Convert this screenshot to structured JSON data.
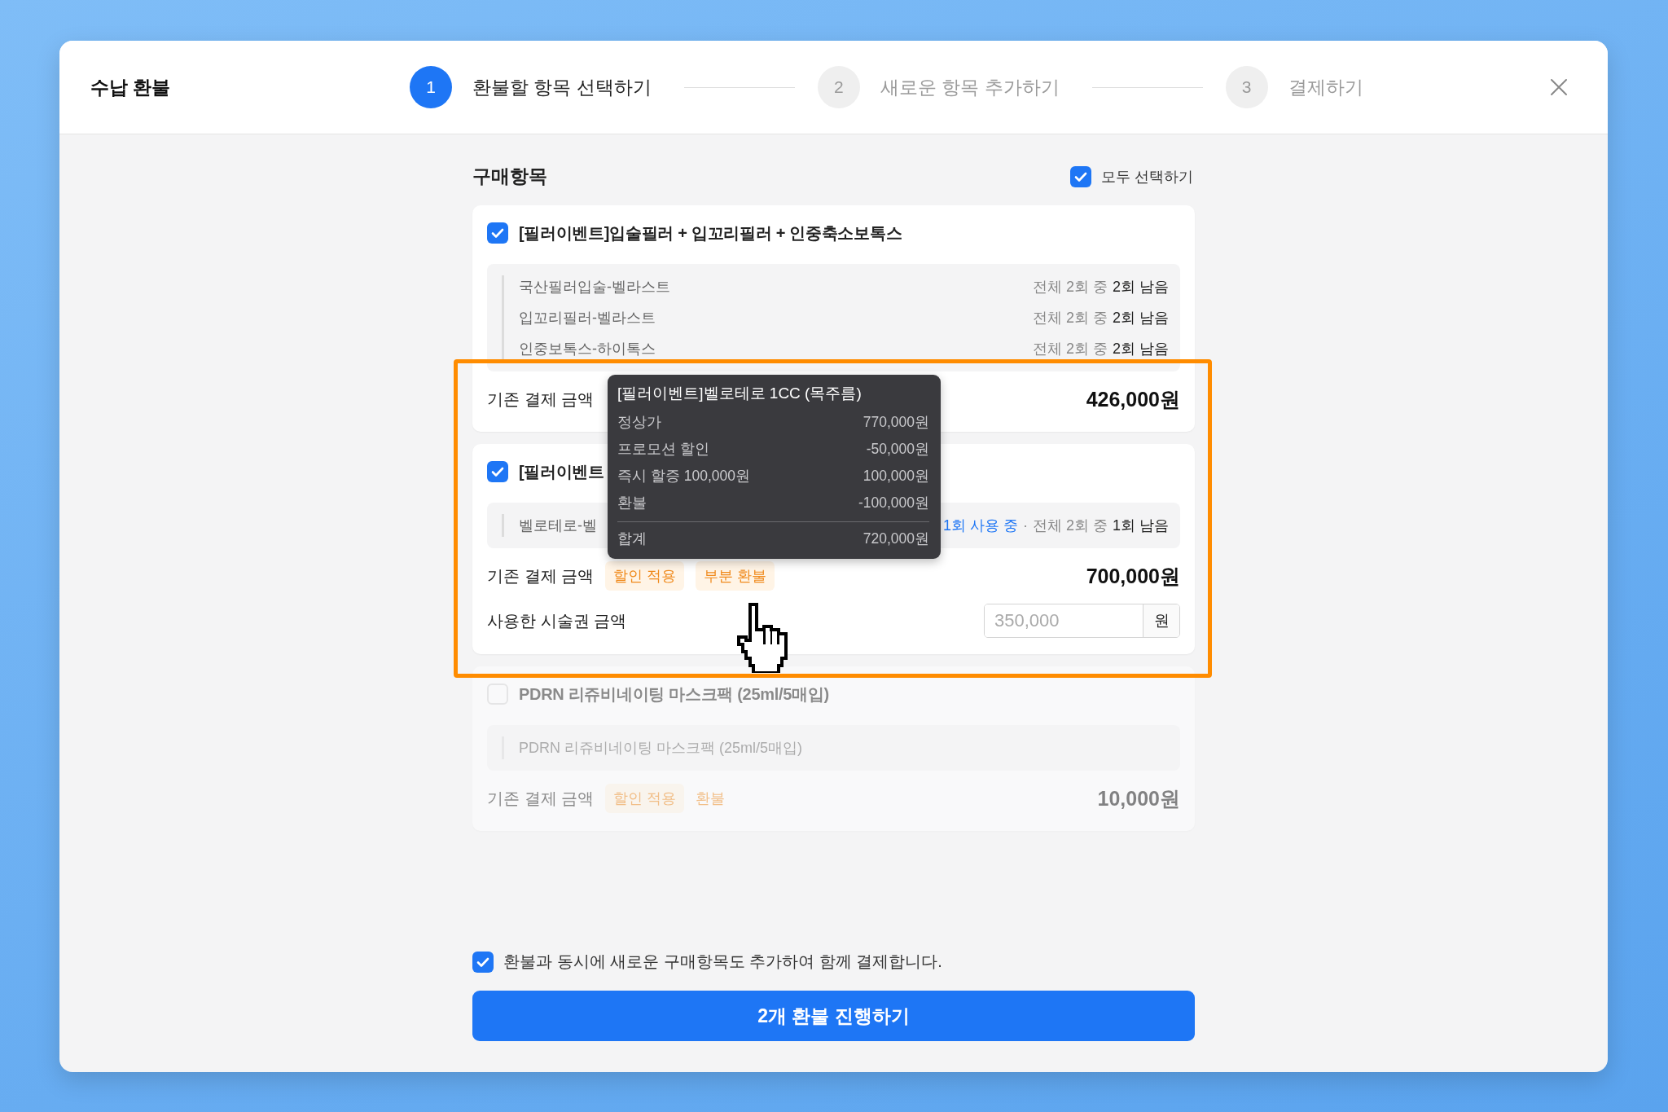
{
  "modal": {
    "title": "수납 환불",
    "steps": [
      {
        "number": "1",
        "label": "환불할 항목 선택하기",
        "selected": true
      },
      {
        "number": "2",
        "label": "새로운 항목 추가하기",
        "selected": false
      },
      {
        "number": "3",
        "label": "결제하기",
        "selected": false
      }
    ]
  },
  "section": {
    "title": "구매항목",
    "select_all": {
      "label": "모두 선택하기",
      "checked": true
    }
  },
  "items": [
    {
      "title": "[필러이벤트]입술필러 + 입꼬리필러 + 인중축소보톡스",
      "checked": true,
      "disabled": false,
      "sub_items": [
        {
          "name": "국산필러입술-벨라스트",
          "total": "전체 2회 중",
          "remaining": "2회 남음"
        },
        {
          "name": "입꼬리필러-벨라스트",
          "total": "전체 2회 중",
          "remaining": "2회 남음"
        },
        {
          "name": "인중보톡스-하이톡스",
          "total": "전체 2회 중",
          "remaining": "2회 남음"
        }
      ],
      "price_label": "기존 결제 금액",
      "amount": "426,000원"
    },
    {
      "title": "[필러이벤트",
      "checked": true,
      "disabled": false,
      "sub_items": [
        {
          "name": "벨로테로-벨",
          "usage": "1회 사용 중",
          "separator": "·",
          "total": "전체 2회 중",
          "remaining": "1회 남음"
        }
      ],
      "price_label": "기존 결제 금액",
      "tags": [
        {
          "label": "할인 적용",
          "kind": "badge"
        },
        {
          "label": "부분 환불",
          "kind": "badge"
        }
      ],
      "amount": "700,000원",
      "used_ticket": {
        "label": "사용한 시술권 금액",
        "placeholder": "350,000",
        "unit": "원"
      }
    },
    {
      "title": "PDRN 리쥬비네이팅 마스크팩 (25ml/5매입)",
      "checked": false,
      "disabled": true,
      "sub_items": [
        {
          "name": "PDRN 리쥬비네이팅 마스크팩 (25ml/5매입)"
        }
      ],
      "price_label": "기존 결제 금액",
      "tags": [
        {
          "label": "할인 적용",
          "kind": "badge"
        },
        {
          "label": "환불",
          "kind": "text"
        }
      ],
      "amount": "10,000원"
    }
  ],
  "tooltip": {
    "title": "[필러이벤트]벨로테로 1CC (목주름)",
    "rows": [
      {
        "label": "정상가",
        "value": "770,000원"
      },
      {
        "label": "프로모션 할인",
        "value": "-50,000원"
      },
      {
        "label": "즉시 할증 100,000원",
        "value": "100,000원"
      },
      {
        "label": "환불",
        "value": "-100,000원"
      }
    ],
    "total": {
      "label": "합계",
      "value": "720,000원"
    }
  },
  "footer": {
    "option": {
      "label": "환불과 동시에 새로운 구매항목도 추가하여 함께 결제합니다.",
      "checked": true
    },
    "button": "2개 환불 진행하기"
  }
}
